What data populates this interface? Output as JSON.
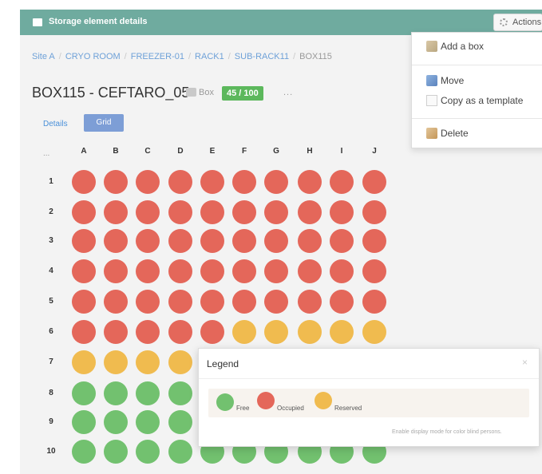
{
  "header": {
    "title": "Storage element details",
    "actions_label": "Actions"
  },
  "breadcrumb": [
    {
      "label": "Site A"
    },
    {
      "label": "CRYO ROOM"
    },
    {
      "label": "FREEZER-01"
    },
    {
      "label": "RACK1"
    },
    {
      "label": "SUB-RACK11"
    },
    {
      "label": "BOX115"
    }
  ],
  "breadcrumb_separator": "/",
  "box": {
    "title": "BOX115 - CEFTARO_05",
    "type_label": "Box",
    "occupancy": "45 / 100",
    "more": "..."
  },
  "tabs": {
    "details": "Details",
    "grid": "Grid"
  },
  "grid": {
    "corner": "...",
    "columns": [
      "A",
      "B",
      "C",
      "D",
      "E",
      "F",
      "G",
      "H",
      "I",
      "J"
    ],
    "rows": [
      "1",
      "2",
      "3",
      "4",
      "5",
      "6",
      "7",
      "8",
      "9",
      "10"
    ],
    "state_counts": {
      "occupied": 55,
      "reserved": 15,
      "free": 30
    },
    "cells": [
      [
        "occupied",
        "occupied",
        "occupied",
        "occupied",
        "occupied",
        "occupied",
        "occupied",
        "occupied",
        "occupied",
        "occupied"
      ],
      [
        "occupied",
        "occupied",
        "occupied",
        "occupied",
        "occupied",
        "occupied",
        "occupied",
        "occupied",
        "occupied",
        "occupied"
      ],
      [
        "occupied",
        "occupied",
        "occupied",
        "occupied",
        "occupied",
        "occupied",
        "occupied",
        "occupied",
        "occupied",
        "occupied"
      ],
      [
        "occupied",
        "occupied",
        "occupied",
        "occupied",
        "occupied",
        "occupied",
        "occupied",
        "occupied",
        "occupied",
        "occupied"
      ],
      [
        "occupied",
        "occupied",
        "occupied",
        "occupied",
        "occupied",
        "occupied",
        "occupied",
        "occupied",
        "occupied",
        "occupied"
      ],
      [
        "occupied",
        "occupied",
        "occupied",
        "occupied",
        "occupied",
        "reserved",
        "reserved",
        "reserved",
        "reserved",
        "reserved"
      ],
      [
        "reserved",
        "reserved",
        "reserved",
        "reserved",
        "reserved",
        "reserved",
        "reserved",
        "reserved",
        "reserved",
        "reserved"
      ],
      [
        "free",
        "free",
        "free",
        "free",
        "free",
        "free",
        "free",
        "free",
        "free",
        "free"
      ],
      [
        "free",
        "free",
        "free",
        "free",
        "free",
        "free",
        "free",
        "free",
        "free",
        "free"
      ],
      [
        "free",
        "free",
        "free",
        "free",
        "free",
        "free",
        "free",
        "free",
        "free",
        "free"
      ]
    ]
  },
  "colors": {
    "occupied": "#e4675a",
    "reserved": "#f0bb4f",
    "free": "#72c16f",
    "header_bg": "#6fab9f"
  },
  "actions_menu": {
    "items": [
      {
        "label": "Add a box",
        "icon": "add-box-icon"
      },
      {
        "label": "Move",
        "icon": "move-icon"
      },
      {
        "label": "Copy as a template",
        "icon": "copy-icon"
      },
      {
        "label": "Delete",
        "icon": "delete-icon"
      }
    ]
  },
  "legend": {
    "title": "Legend",
    "close": "×",
    "items": [
      {
        "label": "Free",
        "state": "free"
      },
      {
        "label": "Occupied",
        "state": "occupied"
      },
      {
        "label": "Reserved",
        "state": "reserved"
      }
    ],
    "note": "Enable display mode for color blind persons."
  }
}
